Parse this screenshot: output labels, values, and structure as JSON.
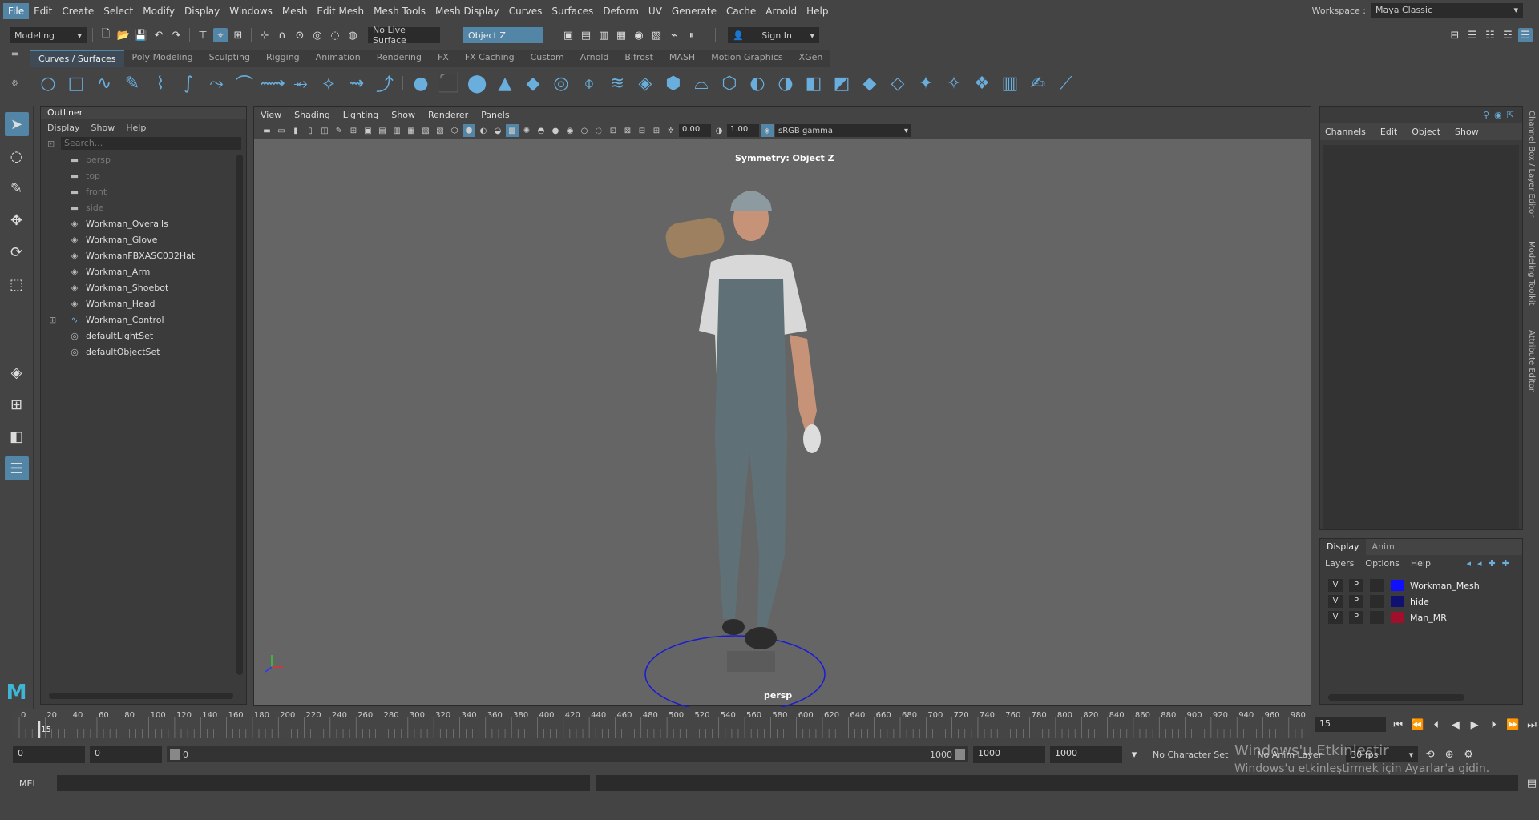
{
  "menus": [
    "File",
    "Edit",
    "Create",
    "Select",
    "Modify",
    "Display",
    "Windows",
    "Mesh",
    "Edit Mesh",
    "Mesh Tools",
    "Mesh Display",
    "Curves",
    "Surfaces",
    "Deform",
    "UV",
    "Generate",
    "Cache",
    "Arnold",
    "Help"
  ],
  "workspace": {
    "label": "Workspace :",
    "value": "Maya Classic"
  },
  "status": {
    "mode": "Modeling",
    "live_surface": "No Live Surface",
    "symmetry": "Object Z",
    "sign_in": "Sign In"
  },
  "shelf_tabs": [
    "Curves / Surfaces",
    "Poly Modeling",
    "Sculpting",
    "Rigging",
    "Animation",
    "Rendering",
    "FX",
    "FX Caching",
    "Custom",
    "Arnold",
    "Bifrost",
    "MASH",
    "Motion Graphics",
    "XGen"
  ],
  "outliner": {
    "title": "Outliner",
    "menu": [
      "Display",
      "Show",
      "Help"
    ],
    "search_placeholder": "Search...",
    "items": [
      {
        "label": "persp",
        "icon": "camera-icon",
        "dim": true
      },
      {
        "label": "top",
        "icon": "camera-icon",
        "dim": true
      },
      {
        "label": "front",
        "icon": "camera-icon",
        "dim": true
      },
      {
        "label": "side",
        "icon": "camera-icon",
        "dim": true
      },
      {
        "label": "Workman_Overalls",
        "icon": "mesh-icon",
        "dim": false
      },
      {
        "label": "Workman_Glove",
        "icon": "mesh-icon",
        "dim": false
      },
      {
        "label": "WorkmanFBXASC032Hat",
        "icon": "mesh-icon",
        "dim": false
      },
      {
        "label": "Workman_Arm",
        "icon": "mesh-icon",
        "dim": false
      },
      {
        "label": "Workman_Shoebot",
        "icon": "mesh-icon",
        "dim": false
      },
      {
        "label": "Workman_Head",
        "icon": "mesh-icon",
        "dim": false
      },
      {
        "label": "Workman_Control",
        "icon": "curve-icon",
        "dim": false
      },
      {
        "label": "defaultLightSet",
        "icon": "set-icon",
        "dim": false
      },
      {
        "label": "defaultObjectSet",
        "icon": "set-icon",
        "dim": false
      }
    ]
  },
  "viewport": {
    "menu": [
      "View",
      "Shading",
      "Lighting",
      "Show",
      "Renderer",
      "Panels"
    ],
    "exposure": "0.00",
    "gamma": "1.00",
    "color_space": "sRGB gamma",
    "symmetry_label": "Symmetry: Object Z",
    "camera": "persp"
  },
  "channel_box": {
    "menu": [
      "Channels",
      "Edit",
      "Object",
      "Show"
    ]
  },
  "layer_editor": {
    "tabs": [
      "Display",
      "Anim"
    ],
    "menu": [
      "Layers",
      "Options",
      "Help"
    ],
    "layers": [
      {
        "v": "V",
        "p": "P",
        "name": "Workman_Mesh",
        "color": "#1010ff"
      },
      {
        "v": "V",
        "p": "P",
        "name": "hide",
        "color": "#101070"
      },
      {
        "v": "V",
        "p": "P",
        "name": "Man_MR",
        "color": "#a0102a"
      }
    ]
  },
  "side_tabs": [
    "Channel Box / Layer Editor",
    "Modeling Toolkit",
    "Attribute Editor"
  ],
  "timeline": {
    "ticks": [
      0,
      20,
      40,
      60,
      80,
      100,
      120,
      140,
      160,
      180,
      200,
      220,
      240,
      260,
      280,
      300,
      320,
      340,
      360,
      380,
      400,
      420,
      440,
      460,
      480,
      500,
      520,
      540,
      560,
      580,
      600,
      620,
      640,
      660,
      680,
      700,
      720,
      740,
      760,
      780,
      800,
      820,
      840,
      860,
      880,
      900,
      920,
      940,
      960,
      980
    ],
    "current": "15",
    "current_frame_field": "15"
  },
  "range": {
    "start": "0",
    "anim_start": "0",
    "slider_left": "0",
    "slider_right": "1000",
    "end": "1000",
    "anim_end": "1000",
    "char_set": "No Character Set",
    "anim_layer": "No Anim Layer",
    "fps": "30 fps"
  },
  "command": {
    "label": "MEL"
  },
  "watermark": {
    "line1": "Windows'u Etkinleştir",
    "line2": "Windows'u etkinleştirmek için Ayarlar'a gidin."
  }
}
